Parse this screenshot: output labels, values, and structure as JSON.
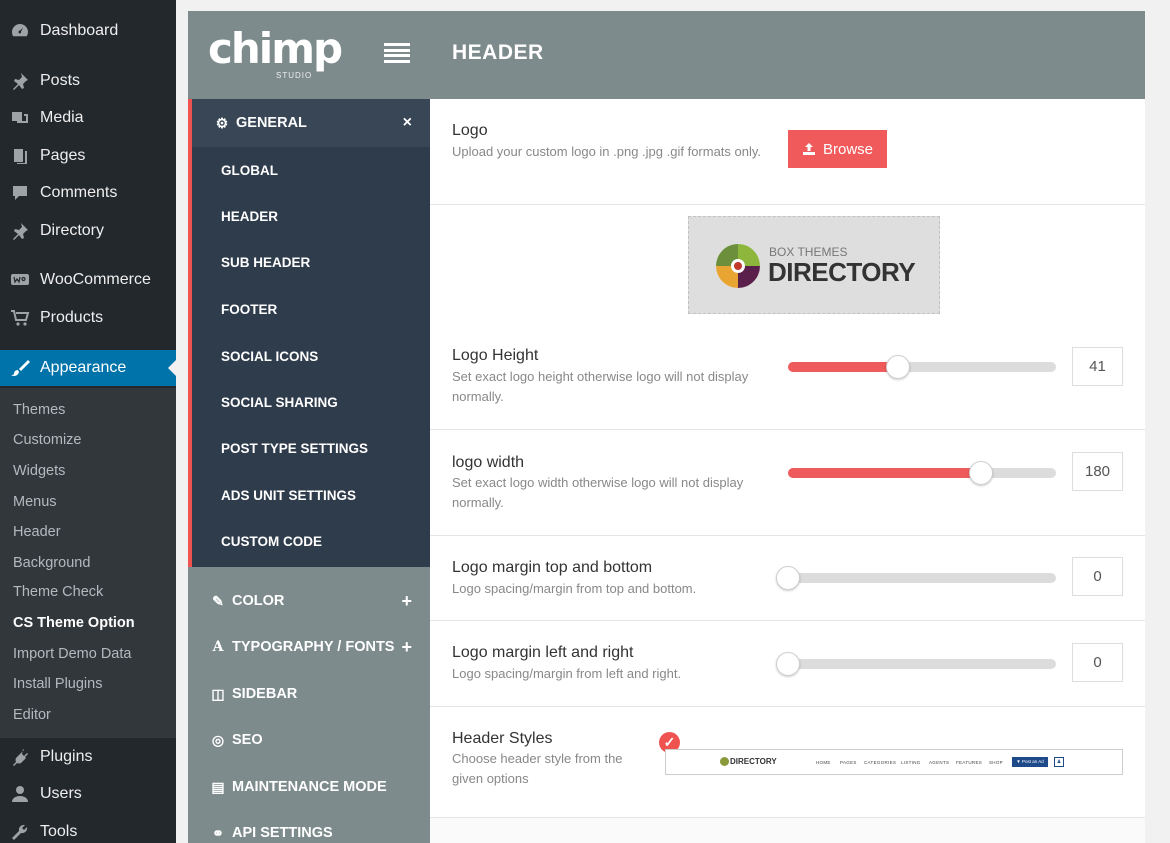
{
  "wp_menu": {
    "items": [
      {
        "label": "Dashboard",
        "icon": "dashboard-icon"
      },
      {
        "label": "Posts",
        "icon": "pin-icon"
      },
      {
        "label": "Media",
        "icon": "media-icon"
      },
      {
        "label": "Pages",
        "icon": "pages-icon"
      },
      {
        "label": "Comments",
        "icon": "comment-icon"
      },
      {
        "label": "Directory",
        "icon": "pin-icon"
      },
      {
        "label": "WooCommerce",
        "icon": "woocommerce-icon"
      },
      {
        "label": "Products",
        "icon": "cart-icon"
      },
      {
        "label": "Appearance",
        "icon": "brush-icon"
      },
      {
        "label": "Plugins",
        "icon": "plug-icon"
      },
      {
        "label": "Users",
        "icon": "user-icon"
      },
      {
        "label": "Tools",
        "icon": "wrench-icon"
      }
    ],
    "submenu": [
      "Themes",
      "Customize",
      "Widgets",
      "Menus",
      "Header",
      "Background",
      "Theme Check",
      "CS Theme Option",
      "Import Demo Data",
      "Install Plugins",
      "Editor"
    ]
  },
  "panel": {
    "brand": "chimp",
    "brand_sub": "STUDIO",
    "title": "HEADER"
  },
  "nav": {
    "general": "GENERAL",
    "general_close": "×",
    "sub_items": [
      "GLOBAL",
      "HEADER",
      "SUB HEADER",
      "FOOTER",
      "SOCIAL ICONS",
      "SOCIAL SHARING",
      "POST TYPE SETTINGS",
      "ADS UNIT SETTINGS",
      "CUSTOM CODE"
    ],
    "groups": [
      {
        "label": "COLOR",
        "icon": "wand-icon",
        "glyph": "✎",
        "plus": "+"
      },
      {
        "label": "TYPOGRAPHY / FONTS",
        "icon": "font-icon",
        "glyph": "A",
        "plus": "+"
      },
      {
        "label": "SIDEBAR",
        "icon": "columns-icon",
        "glyph": "◫",
        "plus": ""
      },
      {
        "label": "SEO",
        "icon": "compass-icon",
        "glyph": "◎",
        "plus": ""
      },
      {
        "label": "MAINTENANCE MODE",
        "icon": "server-icon",
        "glyph": "▤",
        "plus": ""
      },
      {
        "label": "API SETTINGS",
        "icon": "link-icon",
        "glyph": "⚭",
        "plus": ""
      }
    ]
  },
  "logo": {
    "title": "Logo",
    "desc": "Upload your custom logo in .png .jpg .gif formats only.",
    "browse": "Browse",
    "preview_small": "BOX THEMES",
    "preview_big": "DIRECTORY"
  },
  "sliders": [
    {
      "title": "Logo Height",
      "desc": "Set exact logo height otherwise logo will not display normally.",
      "value": "41",
      "level": 0.41
    },
    {
      "title": "logo width",
      "desc": "Set exact logo width otherwise logo will not display normally.",
      "value": "180",
      "level": 0.72
    },
    {
      "title": "Logo margin top and bottom",
      "desc": "Logo spacing/margin from top and bottom.",
      "value": "0",
      "level": 0
    },
    {
      "title": "Logo margin left and right",
      "desc": "Logo spacing/margin from left and right.",
      "value": "0",
      "level": 0
    }
  ],
  "header_styles": {
    "title": "Header Styles",
    "desc": "Choose header style from the given options",
    "check": "✓",
    "preview_brand": "DIRECTORY",
    "preview_nav": [
      "HOME",
      "PAGES",
      "CATEGORIES",
      "LISTING",
      "AGENTS",
      "FEATURES",
      "SHOP"
    ],
    "preview_post": "▼ Post an Ad",
    "preview_login": "♟"
  },
  "colors": {
    "accent": "#ef5350",
    "wp_active": "#0073aa",
    "nav_dark": "#2f3c4c",
    "header_gray": "#7e8b8c"
  }
}
